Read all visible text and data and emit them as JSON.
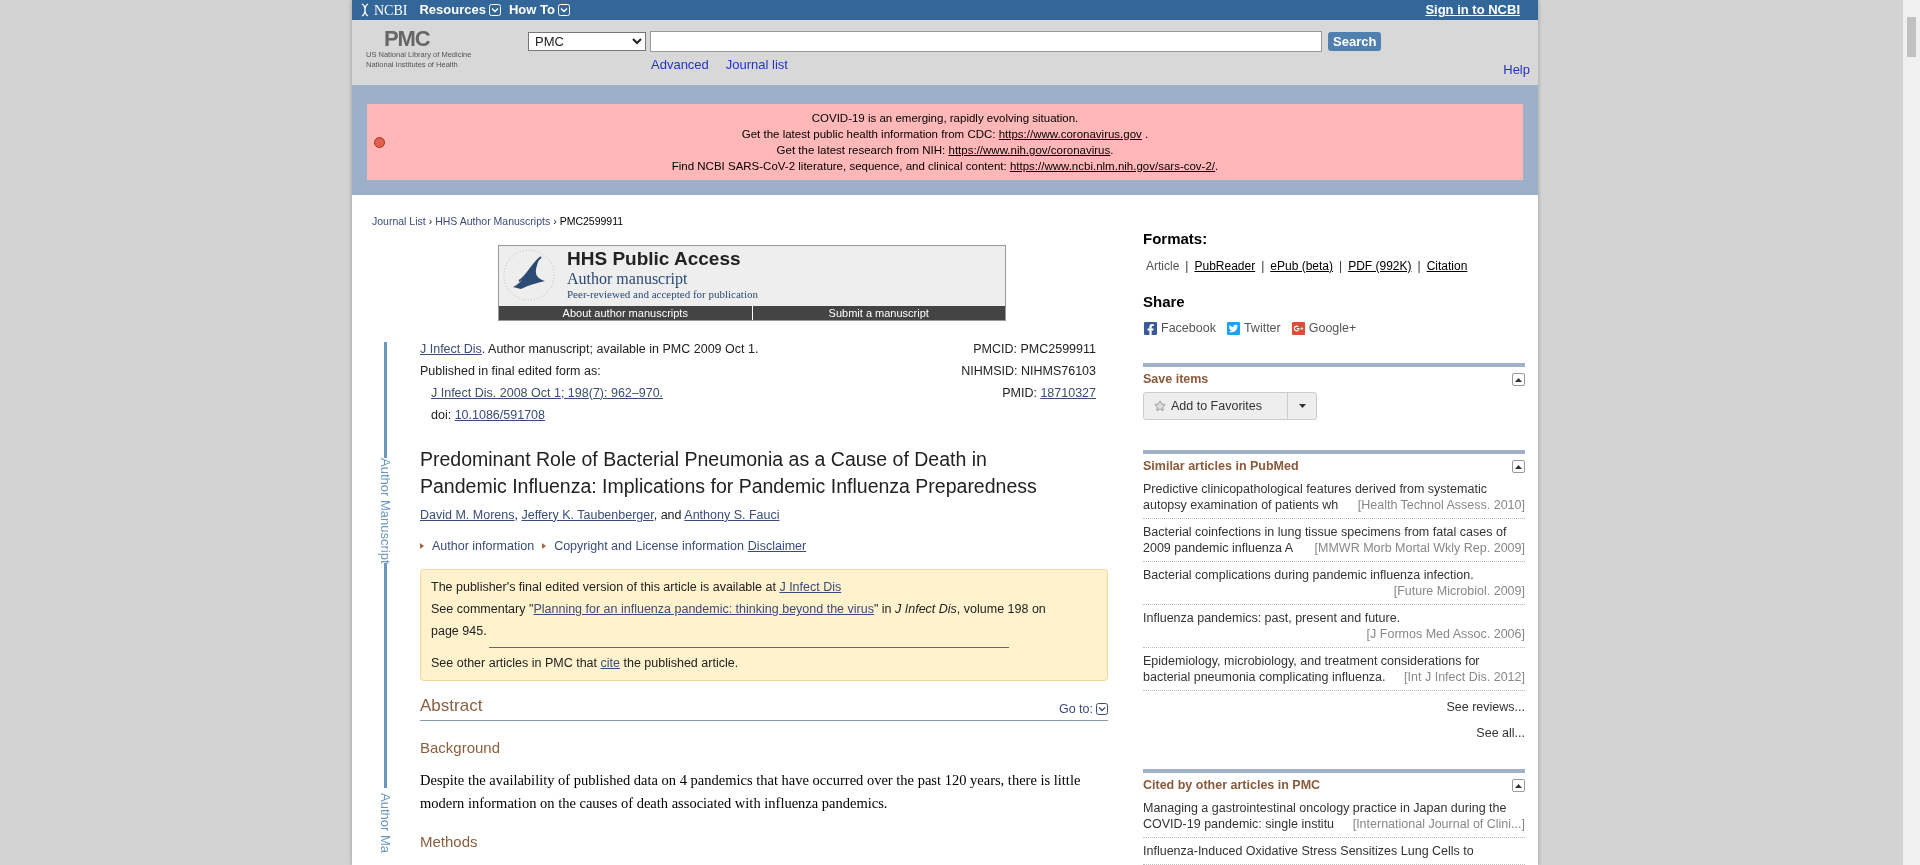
{
  "top_bar": {
    "logo_text": "NCBI",
    "menus": [
      "Resources",
      "How To"
    ],
    "sign_in": "Sign in to NCBI"
  },
  "header": {
    "logo": "PMC",
    "org_lines": [
      "US National Library of Medicine",
      "National Institutes of Health"
    ],
    "database": "PMC",
    "search_button": "Search",
    "links": [
      "Advanced",
      "Journal list"
    ],
    "help": "Help"
  },
  "alert": {
    "lines": [
      [
        {
          "kind": "text",
          "text": "COVID-19 is an emerging, rapidly evolving situation."
        }
      ],
      [
        {
          "kind": "text",
          "text": "Get the latest public health information from CDC: "
        },
        {
          "kind": "link",
          "text": "https://www.coronavirus.gov"
        },
        {
          "kind": "text",
          "text": " ."
        }
      ],
      [
        {
          "kind": "text",
          "text": "Get the latest research from NIH: "
        },
        {
          "kind": "link",
          "text": "https://www.nih.gov/coronavirus"
        },
        {
          "kind": "text",
          "text": "."
        }
      ],
      [
        {
          "kind": "text",
          "text": "Find NCBI SARS-CoV-2 literature, sequence, and clinical content: "
        },
        {
          "kind": "link",
          "text": "https://www.ncbi.nlm.nih.gov/sars-cov-2/"
        },
        {
          "kind": "text",
          "text": "."
        }
      ]
    ]
  },
  "breadcrumb": {
    "separator": "›",
    "items": [
      "Journal List",
      "HHS Author Manuscripts",
      "PMC2599911"
    ]
  },
  "hhs_banner": {
    "title": "HHS Public Access",
    "subtitle": "Author manuscript",
    "tagline": "Peer-reviewed and accepted for publication",
    "buttons": [
      "About author manuscripts",
      "Submit a manuscript"
    ]
  },
  "side_labels": [
    "Author Manuscript",
    "Author Ma"
  ],
  "citation": {
    "lines": [
      [
        {
          "kind": "link",
          "text": "J Infect Dis"
        },
        {
          "kind": "text",
          "text": ". Author manuscript; available in PMC 2009 Oct 1."
        }
      ],
      [
        {
          "kind": "text",
          "text": "Published in final edited form as:"
        }
      ],
      [
        {
          "kind": "link",
          "text": "J Infect Dis. 2008 Oct 1; 198(7): 962–970."
        }
      ],
      [
        {
          "kind": "text",
          "text": "doi: "
        },
        {
          "kind": "link",
          "text": "10.1086/591708"
        }
      ]
    ],
    "ids": [
      {
        "label": "PMCID: ",
        "value": "PMC2599911",
        "kind": "text"
      },
      {
        "label": "NIHMSID: ",
        "value": "NIHMS76103",
        "kind": "text"
      },
      {
        "label": "PMID: ",
        "value": "18710327",
        "kind": "link"
      }
    ]
  },
  "title": "Predominant Role of Bacterial Pneumonia as a Cause of Death in Pandemic Influenza: Implications for Pandemic Influenza Preparedness",
  "authors": {
    "names": [
      "David M. Morens",
      "Jeffery K. Taubenberger",
      "Anthony S. Fauci"
    ],
    "separator": ",",
    "conjunction": "and"
  },
  "info": {
    "toggles": [
      "Author information",
      "Copyright and License information"
    ],
    "disclaimer": "Disclaimer"
  },
  "notice": {
    "lines": [
      [
        {
          "kind": "text",
          "text": "The publisher's final edited version of this article is available at "
        },
        {
          "kind": "link",
          "text": "J Infect Dis"
        }
      ],
      [
        {
          "kind": "text",
          "text": "See commentary \""
        },
        {
          "kind": "link",
          "text": "Planning for an influenza pandemic: thinking beyond the virus"
        },
        {
          "kind": "text",
          "text": "\" in "
        },
        {
          "kind": "italic",
          "text": "J Infect Dis"
        },
        {
          "kind": "text",
          "text": ", volume 198 on page 945."
        }
      ]
    ],
    "footer": [
      {
        "kind": "text",
        "text": "See other articles in PMC that "
      },
      {
        "kind": "link",
        "text": "cite"
      },
      {
        "kind": "text",
        "text": " the published article."
      }
    ]
  },
  "abstract": {
    "heading": "Abstract",
    "goto": "Go to:",
    "sections": [
      {
        "heading": "Background",
        "text": "Despite the availability of published data on 4 pandemics that have occurred over the past 120 years, there is little modern information on the causes of death associated with influenza pandemics."
      },
      {
        "heading": "Methods"
      }
    ]
  },
  "sidebar": {
    "formats": {
      "heading": "Formats:",
      "separator": "|",
      "items": [
        {
          "label": "Article",
          "selected": true
        },
        {
          "label": "PubReader",
          "selected": false
        },
        {
          "label": "ePub (beta)",
          "selected": false
        },
        {
          "label": "PDF (992K)",
          "selected": false
        },
        {
          "label": "Citation",
          "selected": false
        }
      ]
    },
    "share": {
      "heading": "Share",
      "items": [
        {
          "kind": "facebook",
          "label": "Facebook"
        },
        {
          "kind": "twitter",
          "label": "Twitter"
        },
        {
          "kind": "googleplus",
          "label": "Google+"
        }
      ]
    },
    "save": {
      "heading": "Save items",
      "button": "Add to Favorites"
    },
    "similar": {
      "heading": "Similar articles in PubMed",
      "items": [
        {
          "title": "Predictive clinicopathological features derived from systematic autopsy examination of patients wh",
          "source": "[Health Technol Assess. 2010]"
        },
        {
          "title": "Bacterial coinfections in lung tissue specimens from fatal cases of 2009 pandemic influenza A ",
          "source": "[MMWR Morb Mortal Wkly Rep. 2009]"
        },
        {
          "title": "Bacterial complications during pandemic influenza infection.",
          "source": "[Future Microbiol. 2009]"
        },
        {
          "title": "Influenza pandemics: past, present and future.",
          "source": "[J Formos Med Assoc. 2006]"
        },
        {
          "title": "Epidemiology, microbiology, and treatment considerations for bacterial pneumonia complicating influenza.",
          "source": "[Int J Infect Dis. 2012]"
        }
      ],
      "more": [
        "See reviews...",
        "See all..."
      ]
    },
    "cited": {
      "heading": "Cited by other articles in PMC",
      "items": [
        {
          "title": "Managing a gastrointestinal oncology practice in Japan during the COVID-19 pandemic: single institu",
          "source": "[International Journal of Clini...]"
        },
        {
          "title": "Influenza-Induced Oxidative Stress Sensitizes Lung Cells to"
        }
      ]
    }
  }
}
